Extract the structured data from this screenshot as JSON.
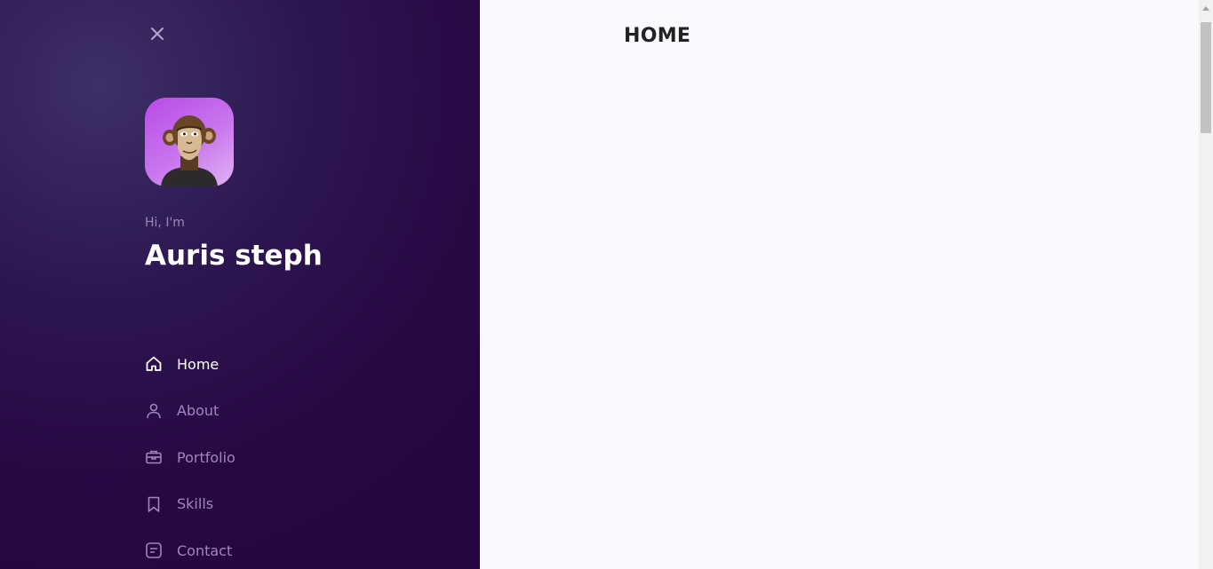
{
  "sidebar": {
    "greeting": "Hi, I'm",
    "name": "Auris steph",
    "nav": [
      {
        "label": "Home",
        "icon": "home-icon",
        "active": true
      },
      {
        "label": "About",
        "icon": "user-icon",
        "active": false
      },
      {
        "label": "Portfolio",
        "icon": "briefcase-icon",
        "active": false
      },
      {
        "label": "Skills",
        "icon": "bookmark-icon",
        "active": false
      },
      {
        "label": "Contact",
        "icon": "message-icon",
        "active": false
      }
    ]
  },
  "main": {
    "title": "HOME"
  },
  "colors": {
    "sidebar_bg": "#270843",
    "nav_active": "#ffffff",
    "nav_inactive": "#a086bc",
    "avatar_accent": "#b94ae8",
    "main_bg": "#fbf8fe"
  }
}
